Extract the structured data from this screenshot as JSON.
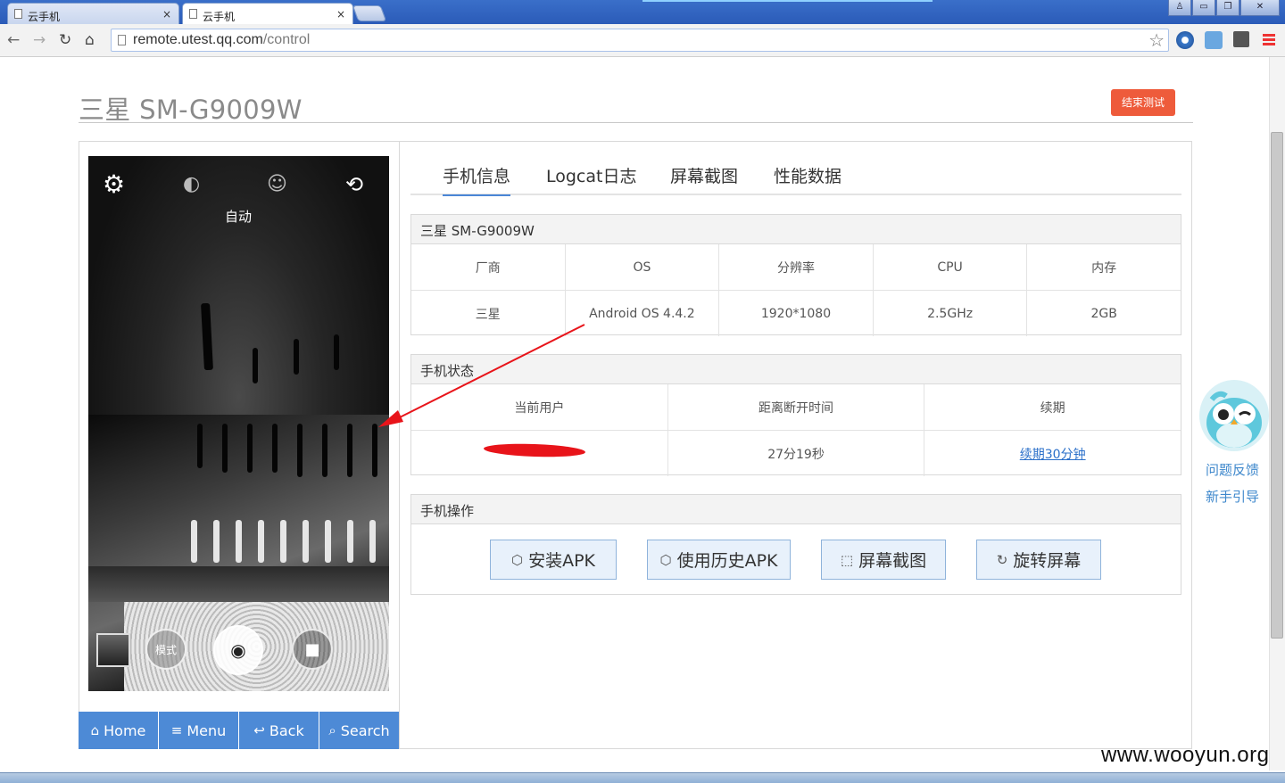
{
  "browser": {
    "tabs": [
      {
        "title": "云手机",
        "active": false
      },
      {
        "title": "云手机",
        "active": true
      }
    ],
    "tab_close_glyph": "×",
    "window_buttons": [
      "♙",
      "▭",
      "❐",
      "✕"
    ],
    "url_host": "remote.utest.qq.com",
    "url_path": "/control",
    "icons": [
      "back-icon",
      "forward-icon",
      "reload-icon",
      "home-icon",
      "star-icon",
      "menu-icon"
    ]
  },
  "header": {
    "device_title": "三星 SM-G9009W",
    "end_test_label": "结束测试"
  },
  "camera": {
    "auto_label": "自动",
    "mode_label": "模式"
  },
  "phone_nav": [
    {
      "label": "Home",
      "icon": "home-icon"
    },
    {
      "label": "Menu",
      "icon": "menu-icon"
    },
    {
      "label": "Back",
      "icon": "back-icon"
    },
    {
      "label": "Search",
      "icon": "search-icon"
    }
  ],
  "tabs": [
    "手机信息",
    "Logcat日志",
    "屏幕截图",
    "性能数据"
  ],
  "device_info": {
    "title": "三星 SM-G9009W",
    "headers": [
      "厂商",
      "OS",
      "分辨率",
      "CPU",
      "内存"
    ],
    "values": [
      "三星",
      "Android OS 4.4.2",
      "1920*1080",
      "2.5GHz",
      "2GB"
    ]
  },
  "phone_status": {
    "title": "手机状态",
    "headers": [
      "当前用户",
      "距离断开时间",
      "续期"
    ],
    "current_user": "",
    "time_left": "27分19秒",
    "renew_link": "续期30分钟"
  },
  "phone_ops": {
    "title": "手机操作",
    "buttons": [
      "安装APK",
      "使用历史APK",
      "屏幕截图",
      "旋转屏幕"
    ]
  },
  "side_help": {
    "feedback": "问题反馈",
    "guide": "新手引导"
  },
  "watermark": "www.wooyun.org",
  "colors": {
    "accent": "#4a86d6",
    "end_test": "#ee5b3b",
    "annotation": "#e8141a"
  }
}
